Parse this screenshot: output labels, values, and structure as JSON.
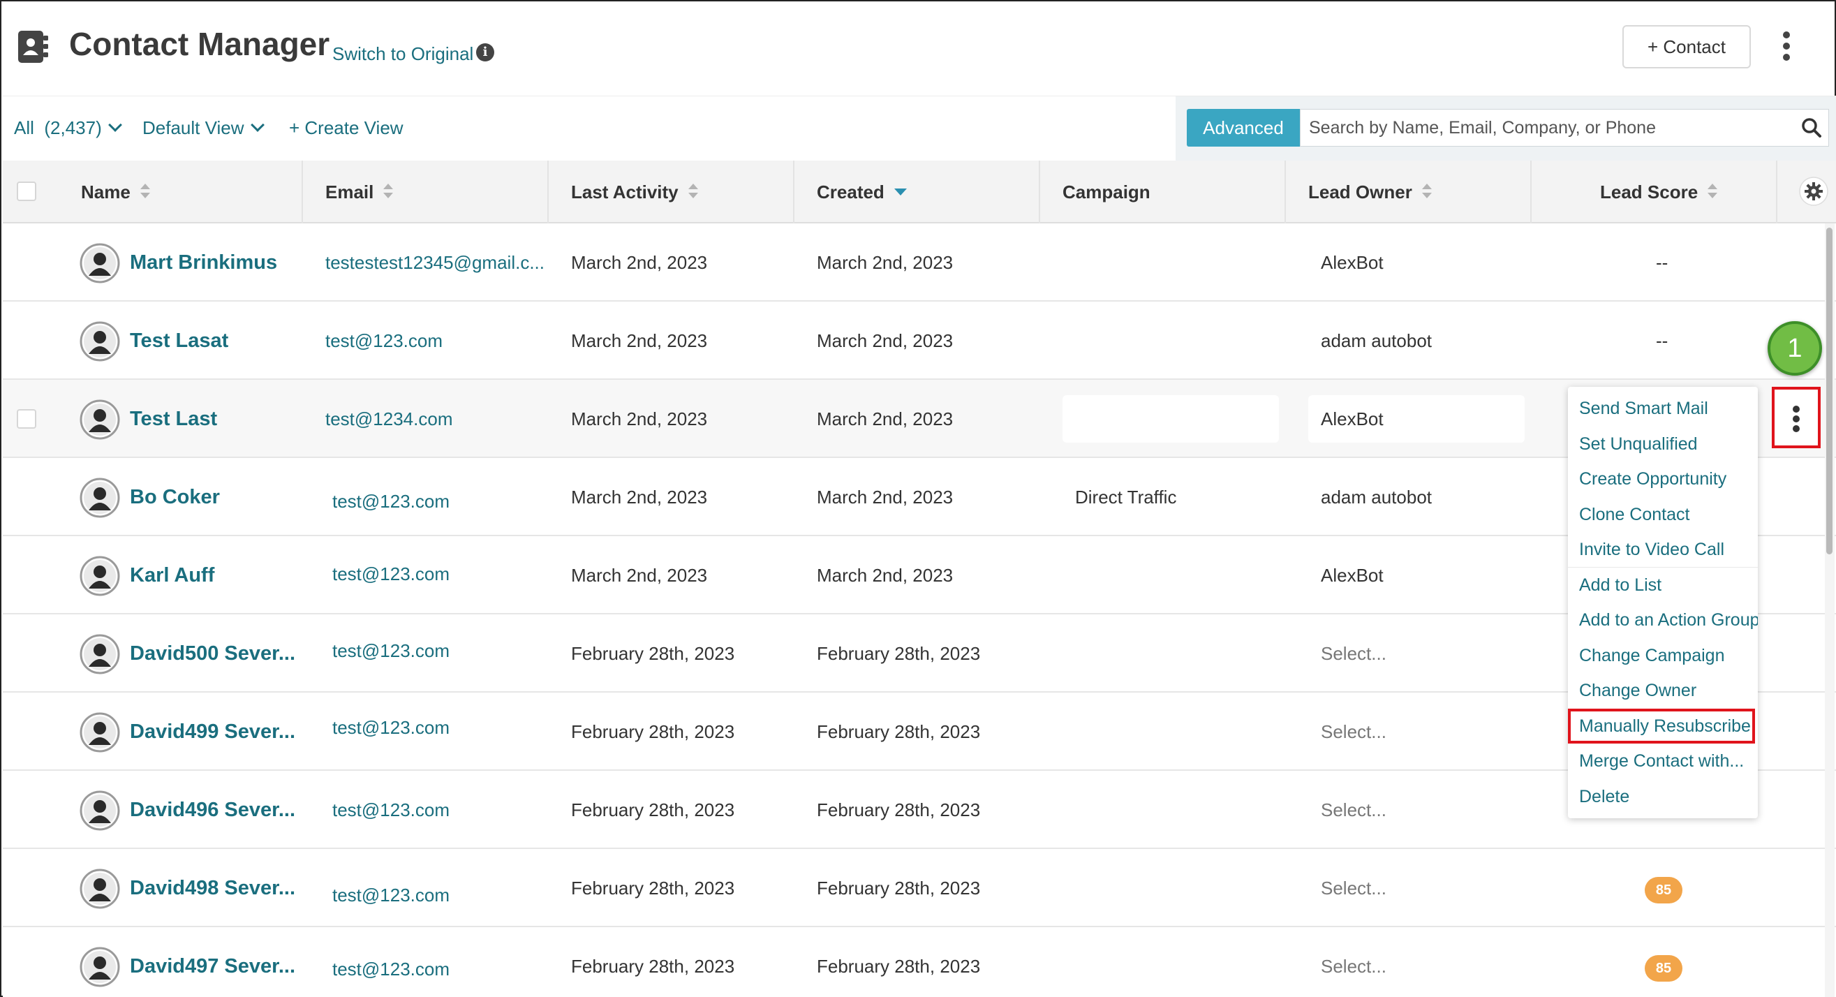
{
  "header": {
    "title": "Contact Manager",
    "switch_link": "Switch to Original",
    "add_contact_label": "+ Contact"
  },
  "toolbar": {
    "filter_all": "All  (2,437)",
    "filter_view": "Default View",
    "create_view": "+ Create View",
    "advanced_label": "Advanced",
    "search_placeholder": "Search by Name, Email, Company, or Phone"
  },
  "table": {
    "columns": {
      "name": "Name",
      "email": "Email",
      "last_activity": "Last Activity",
      "created": "Created",
      "campaign": "Campaign",
      "lead_owner": "Lead Owner",
      "lead_score": "Lead Score"
    },
    "rows": [
      {
        "name": "Mart Brinkimus",
        "email": "testestest12345@gmail.c...",
        "last_activity": "March 2nd, 2023",
        "created": "March 2nd, 2023",
        "campaign": "",
        "lead_owner": "AlexBot",
        "lead_score": "--"
      },
      {
        "name": "Test Lasat",
        "email": "test@123.com",
        "last_activity": "March 2nd, 2023",
        "created": "March 2nd, 2023",
        "campaign": "",
        "lead_owner": "adam autobot",
        "lead_score": "--"
      },
      {
        "name": "Test Last",
        "email": "test@1234.com",
        "last_activity": "March 2nd, 2023",
        "created": "March 2nd, 2023",
        "campaign": "",
        "lead_owner": "AlexBot",
        "lead_score": ""
      },
      {
        "name": "Bo Coker",
        "email": "test@123.com",
        "last_activity": "March 2nd, 2023",
        "created": "March 2nd, 2023",
        "campaign": "Direct Traffic",
        "lead_owner": "adam autobot",
        "lead_score": ""
      },
      {
        "name": "Karl Auff",
        "email": "test@123.com",
        "last_activity": "March 2nd, 2023",
        "created": "March 2nd, 2023",
        "campaign": "",
        "lead_owner": "AlexBot",
        "lead_score": ""
      },
      {
        "name": "David500 Sever...",
        "email": "test@123.com",
        "last_activity": "February 28th, 2023",
        "created": "February 28th, 2023",
        "campaign": "",
        "lead_owner": "Select...",
        "lead_score": ""
      },
      {
        "name": "David499 Sever...",
        "email": "test@123.com",
        "last_activity": "February 28th, 2023",
        "created": "February 28th, 2023",
        "campaign": "",
        "lead_owner": "Select...",
        "lead_score": ""
      },
      {
        "name": "David496 Sever...",
        "email": "test@123.com",
        "last_activity": "February 28th, 2023",
        "created": "February 28th, 2023",
        "campaign": "",
        "lead_owner": "Select...",
        "lead_score": ""
      },
      {
        "name": "David498 Sever...",
        "email": "test@123.com",
        "last_activity": "February 28th, 2023",
        "created": "February 28th, 2023",
        "campaign": "",
        "lead_owner": "Select...",
        "lead_score": "85"
      },
      {
        "name": "David497 Sever...",
        "email": "test@123.com",
        "last_activity": "February 28th, 2023",
        "created": "February 28th, 2023",
        "campaign": "",
        "lead_owner": "Select...",
        "lead_score": "85"
      }
    ]
  },
  "step_marker": "1",
  "context_menu": {
    "items": [
      "Send Smart Mail",
      "Set Unqualified",
      "Create Opportunity",
      "Clone Contact",
      "Invite to Video Call",
      "Add to List",
      "Add to an Action Group",
      "Change Campaign",
      "Change Owner",
      "Manually Resubscribe",
      "Merge Contact with...",
      "Delete"
    ],
    "highlighted_item": "Manually Resubscribe"
  },
  "colors": {
    "link_teal": "#1a6e7e",
    "advanced_button": "#3aa6c2",
    "score_badge": "#f2a54a",
    "step_marker": "#71bd45",
    "highlight_red": "#e0141c"
  },
  "icons": [
    "contact-book-icon",
    "info-icon",
    "more-vertical-icon",
    "search-icon",
    "gear-icon",
    "avatar-icon",
    "sort-icon",
    "chevron-down-icon"
  ]
}
